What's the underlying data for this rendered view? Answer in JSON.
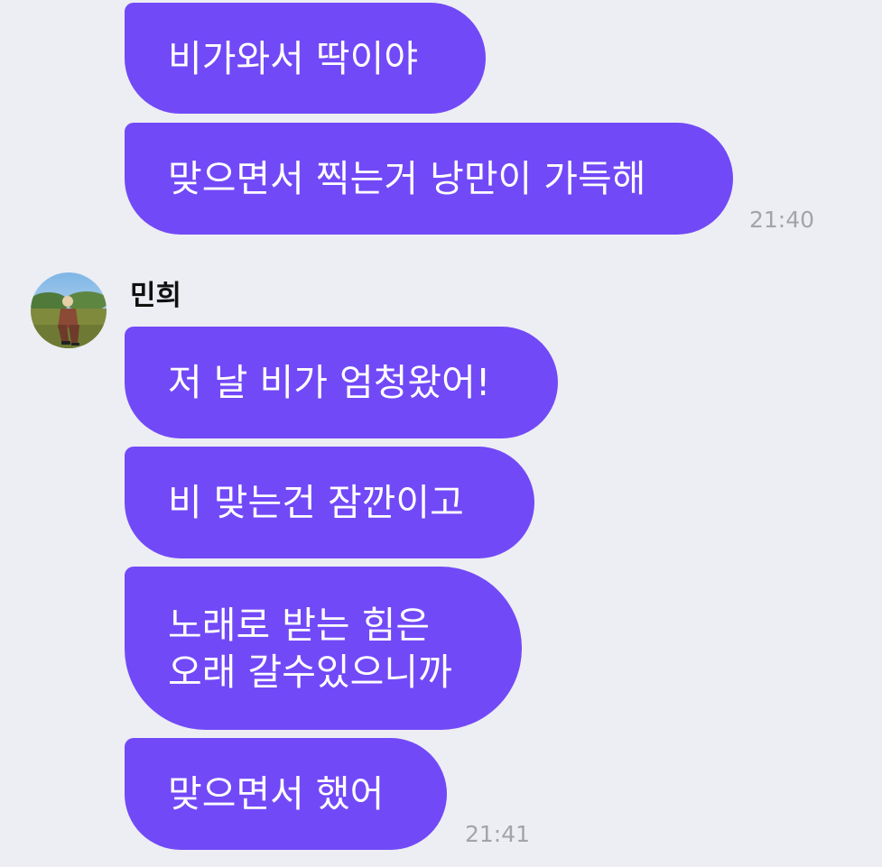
{
  "conversation": {
    "my_messages": [
      {
        "text": "비가와서 딱이야"
      },
      {
        "text": "맞으면서 찍는거 낭만이 가득해"
      }
    ],
    "my_time": "21:40",
    "other": {
      "name": "민희",
      "avatar_icon": "profile-photo-avatar",
      "messages": [
        {
          "text": "저 날 비가 엄청왔어!"
        },
        {
          "text": "비 맞는건 잠깐이고"
        },
        {
          "lines": [
            "노래로 받는 힘은",
            "오래 갈수있으니까"
          ]
        },
        {
          "text": "맞으면서 했어"
        }
      ],
      "time": "21:41"
    }
  },
  "colors": {
    "background": "#eceef3",
    "bubble": "#7249f7",
    "bubble_text": "#ffffff",
    "timestamp": "#a2a4aa",
    "sender_name": "#111111"
  }
}
